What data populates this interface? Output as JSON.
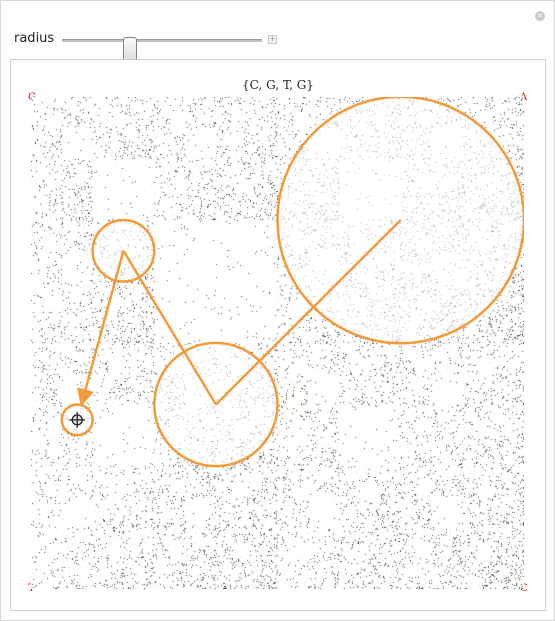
{
  "control": {
    "label": "radius",
    "slider_fraction": 0.34
  },
  "panel": {
    "title": "{C, G, T, G}",
    "corners": {
      "top_left": "G",
      "top_right": "A",
      "bottom_left": "T",
      "bottom_right": "C"
    }
  },
  "colors": {
    "accent": "#f39a3b",
    "corner_label": "#cc1a1a",
    "fractal_dark": "#555555",
    "background": "#ffffff"
  },
  "overlay": {
    "path_points": [
      [
        0.75,
        0.25
      ],
      [
        0.375,
        0.625
      ],
      [
        0.1875,
        0.3125
      ],
      [
        0.09375,
        0.65625
      ]
    ],
    "circle_radii": [
      0.25,
      0.125,
      0.0625,
      0.03125
    ],
    "cursor_icon": "crosshair-icon"
  }
}
